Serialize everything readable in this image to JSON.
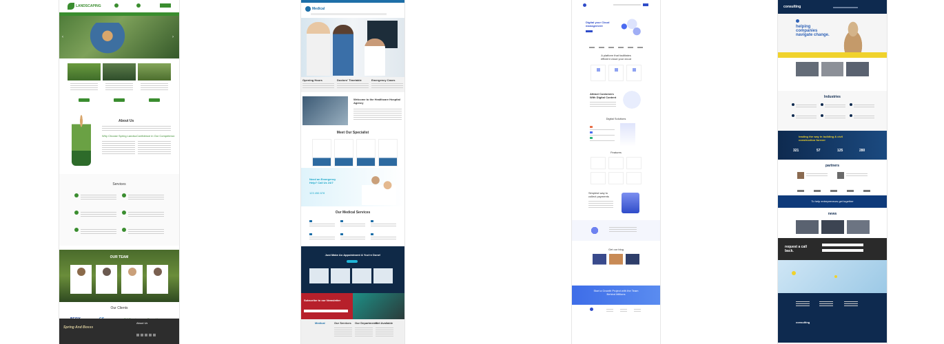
{
  "thumbs": {
    "landscaping": {
      "logo": "LANDSCAPING",
      "sections": {
        "services_title": "Services",
        "team_title": "OUR TEAM",
        "clients_title": "Our Clients",
        "about_title": "About Us",
        "why_choose": "Why Choose Spring Landscaping?",
        "confidence": "Confidence in Our Competence"
      },
      "clients": [
        "BESIX",
        "GS",
        "Tall Poppies",
        "Emerald"
      ],
      "footer_brand": "Spring And Bosss",
      "footer_about": "About Us"
    },
    "medical": {
      "logo": "Medical",
      "welcome_title": "Welcome to the Healthcare Hospital Agency",
      "specialist_title": "Meet Our Specialist",
      "emergency_title": "Need an Emergency Help? Call Us 24/7",
      "phone": "123 456 678",
      "services_title": "Our Medical Services",
      "appointment_title": "Just Make An Appointment & You're Done!",
      "newsletter_title": "Subscribe to our Newsletter",
      "info_cols": [
        "Opening Hours",
        "Doctors' Timetable",
        "Emergency Cases"
      ],
      "footer_cols": [
        "Our Services",
        "Our Departments",
        "Get Available"
      ]
    },
    "cloud": {
      "hero_title": "Digital your Cloud management",
      "section1": "A platform that facilitates efficient cloud your cloud",
      "section2": "Attract Customers With Digital Content",
      "section3": "Digital Solutions",
      "section4": "Features",
      "section5": "Simplest way to collect payments",
      "blog": "Get our blog",
      "cta": "Start a Growth Project with the Team Behind Millions"
    },
    "consulting": {
      "logo": "consulting",
      "hero": "helping companies navigate change.",
      "industries": "Industries",
      "banner": "leading the way in building & civil construction forever",
      "stats": [
        "321",
        "57",
        "125",
        "280"
      ],
      "partners": "partners",
      "cta": "To help entrepreneurs get together",
      "news": "news",
      "request": "request a call back."
    }
  },
  "colors": {
    "landscape_green": "#3a8d2f",
    "medical_blue": "#1e6fa8",
    "cloud_blue": "#2f4cc9",
    "consult_navy": "#0e2a4f",
    "consult_yellow": "#f0d22c"
  }
}
